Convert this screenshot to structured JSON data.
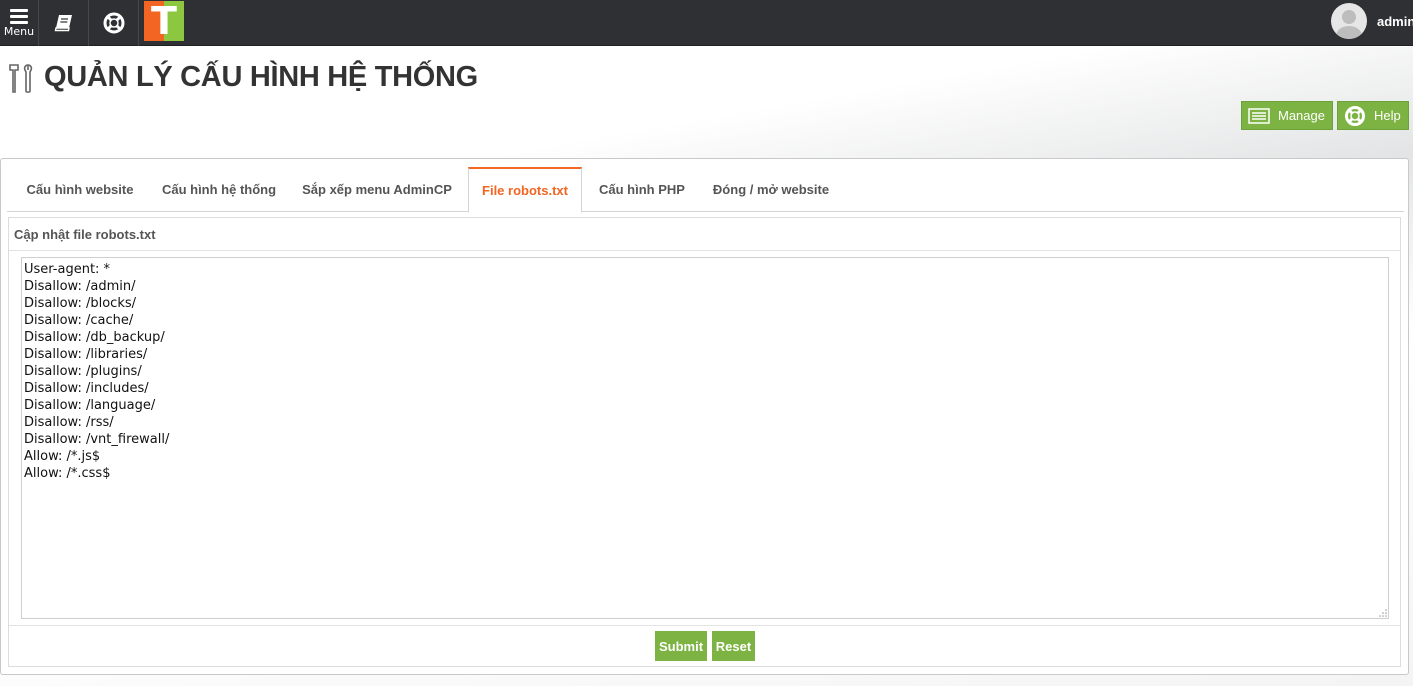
{
  "topbar": {
    "menu_label": "Menu",
    "logo_letter": "T",
    "username": "admin"
  },
  "page": {
    "title": "QUẢN LÝ CẤU HÌNH HỆ THỐNG",
    "manage_label": "Manage",
    "help_label": "Help"
  },
  "tabs": [
    {
      "label": "Cấu hình website",
      "active": false
    },
    {
      "label": "Cấu hình hệ thống",
      "active": false
    },
    {
      "label": "Sắp xếp menu AdminCP",
      "active": false
    },
    {
      "label": "File robots.txt",
      "active": true
    },
    {
      "label": "Cấu hình PHP",
      "active": false
    },
    {
      "label": "Đóng / mở website",
      "active": false
    }
  ],
  "form": {
    "heading": "Cập nhật file robots.txt",
    "content": "User-agent: *\nDisallow: /admin/\nDisallow: /blocks/\nDisallow: /cache/\nDisallow: /db_backup/\nDisallow: /libraries/\nDisallow: /plugins/\nDisallow: /includes/\nDisallow: /language/\nDisallow: /rss/\nDisallow: /vnt_firewall/\nAllow: /*.js$\nAllow: /*.css$",
    "submit_label": "Submit",
    "reset_label": "Reset"
  },
  "colors": {
    "topbar": "#2f3033",
    "accent_orange": "#f26522",
    "accent_green": "#7cb342"
  }
}
